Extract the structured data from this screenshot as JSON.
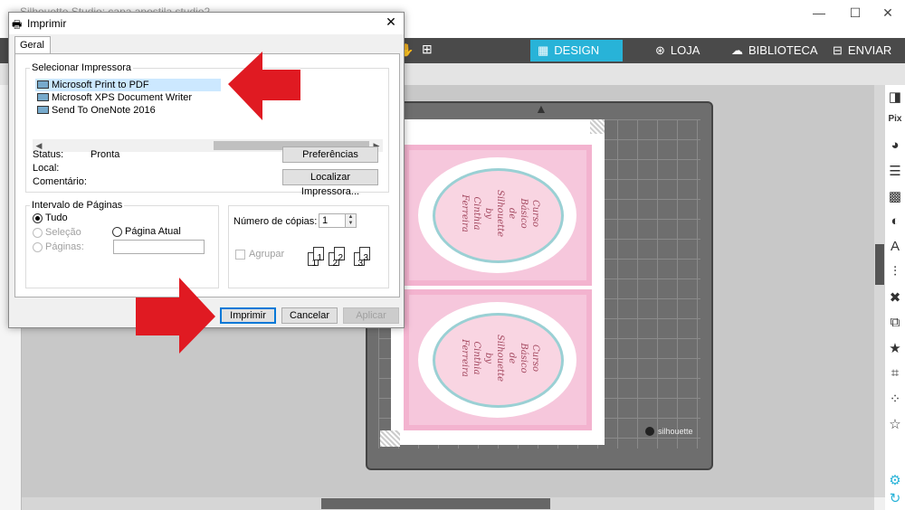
{
  "app": {
    "title": "Silhouette Studio: capa apostila studio2",
    "minimize": "—",
    "maximize": "☐",
    "close": "✕",
    "tabs": [
      {
        "label": "DESIGN",
        "icon": "grid-icon"
      },
      {
        "label": "LOJA",
        "icon": "store-icon"
      },
      {
        "label": "BIBLIOTECA",
        "icon": "cloud-icon"
      },
      {
        "label": "ENVIAR",
        "icon": "cutter-icon"
      }
    ],
    "mat_brand": "silhouette",
    "accent": "#28b3d8"
  },
  "card": {
    "lines": [
      "Curso Básico",
      "de",
      "Silhouette",
      "by",
      "Cinthia Ferreira"
    ]
  },
  "dialog": {
    "title": "Imprimir",
    "close": "✕",
    "tab": "Geral",
    "printer_group": "Selecionar Impressora",
    "printers": [
      "Microsoft Print to PDF",
      "Microsoft XPS Document Writer",
      "Send To OneNote 2016"
    ],
    "selected_printer": 0,
    "status_label": "Status:",
    "status_value": "Pronta",
    "location_label": "Local:",
    "comment_label": "Comentário:",
    "preferences_button": "Preferências",
    "find_printer_button": "Localizar Impressora...",
    "page_range_group": "Intervalo de Páginas",
    "range_all": "Tudo",
    "range_selection": "Seleção",
    "range_current": "Página Atual",
    "range_pages": "Páginas:",
    "copies_label": "Número de cópias:",
    "copies_value": "1",
    "collate_label": "Agrupar",
    "collate_pages": [
      "1",
      "1",
      "2",
      "2",
      "3",
      "3"
    ],
    "print_button": "Imprimir",
    "cancel_button": "Cancelar",
    "apply_button": "Aplicar"
  }
}
